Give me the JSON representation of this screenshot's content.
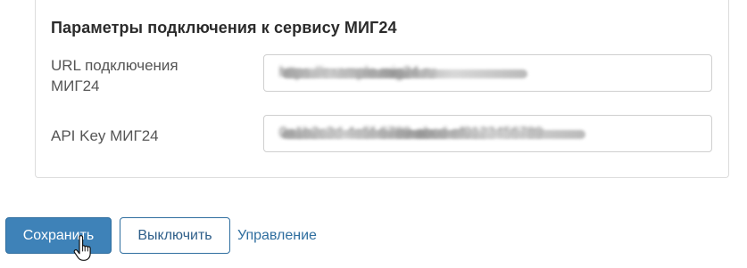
{
  "panel": {
    "title": "Параметры подключения к сервису МИГ24",
    "fields": [
      {
        "label_line1": "URL подключения",
        "label_line2": "МИГ24",
        "value": "https://example.mig24.ru",
        "value_obscured": true
      },
      {
        "label": "API Key МИГ24",
        "value": "0a1b2c3d-4e5f-6789-abcd-ef0123456789",
        "value_obscured": true
      }
    ]
  },
  "actions": {
    "save_label": "Сохранить",
    "disable_label": "Выключить",
    "manage_label": "Управление"
  },
  "colors": {
    "primary": "#3e82b8",
    "primary_border": "#2f6e9f",
    "link": "#2f6e9f",
    "panel_border": "#dcdcdc"
  },
  "icons": {
    "cursor": "hand-pointer-icon"
  }
}
